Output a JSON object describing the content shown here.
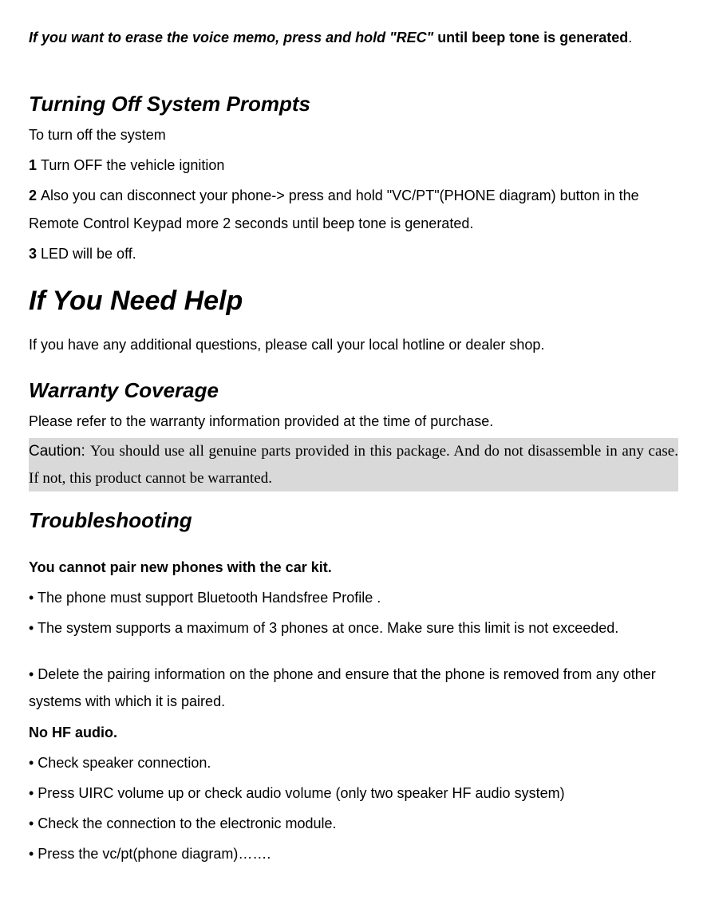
{
  "erase": {
    "italic_bold": "If you want to erase the voice memo, press and hold \"REC\" ",
    "bold_tail": "until beep tone is generated",
    "period": "."
  },
  "turning_off": {
    "heading": "Turning Off System Prompts",
    "intro": "To turn off the system",
    "step1_num": "1 ",
    "step1_text": "Turn OFF the vehicle ignition",
    "step2_num": "2 ",
    "step2_text": "Also you can disconnect your phone->   press and hold \"VC/PT\"(PHONE diagram) button in the Remote Control Keypad more 2 seconds until beep tone is generated.",
    "step3_num": "3 ",
    "step3_text": "LED will be off."
  },
  "help": {
    "heading": "If You Need Help",
    "text": "If you have any additional questions, please call your local hotline or dealer shop."
  },
  "warranty": {
    "heading": "Warranty Coverage",
    "text": "Please refer to the warranty information provided at the time of purchase.",
    "caution_label": "Caution: ",
    "caution_body": "You should use all genuine parts provided in this package.  And do not disassemble in any case.  If not, this product cannot be warranted."
  },
  "troubleshooting": {
    "heading": "Troubleshooting",
    "issue1_title": "You cannot pair new phones with the car kit.",
    "issue1_b1": "• The phone must support Bluetooth Handsfree Profile .",
    "issue1_b2": "• The system supports a maximum of 3 phones at once. Make sure this limit is not exceeded.",
    "issue1_b3": "• Delete the pairing information on the phone and ensure that the phone is removed from any other systems with which it is paired.",
    "issue2_title": "No HF audio.",
    "issue2_b1": "• Check speaker connection.",
    "issue2_b2": "• Press UIRC volume up or check audio volume (only two speaker HF audio system)",
    "issue2_b3": "• Check the connection to the electronic module.",
    "issue2_b4": "• Press the vc/pt(phone diagram)……."
  }
}
